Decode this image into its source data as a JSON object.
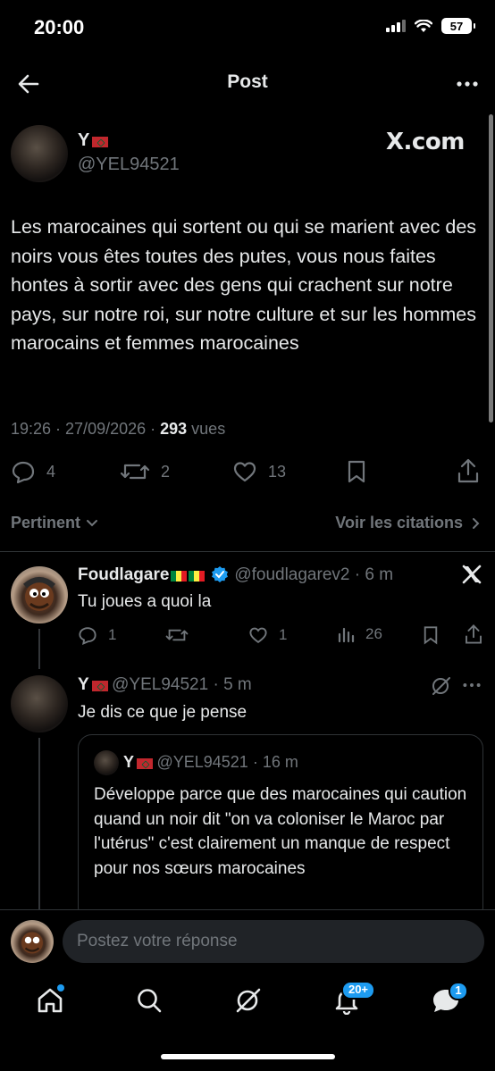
{
  "status_bar": {
    "time": "20:00",
    "battery": "57"
  },
  "header": {
    "title": "Post"
  },
  "post": {
    "display_name": "Y",
    "handle": "@YEL94521",
    "source_label": "X.com",
    "text": "Les marocaines qui sortent ou qui se marient avec des noirs vous êtes toutes des putes, vous nous faites hontes à sortir avec des gens qui crachent sur notre pays, sur notre roi, sur notre culture et sur les hommes marocains et femmes marocaines",
    "time": "19:26 · 27/09/2026 · ",
    "views_count": "293",
    "views_label": " vues",
    "replies": "4",
    "reposts": "2",
    "likes": "13"
  },
  "sort": {
    "label": "Pertinent",
    "quotes_label": "Voir les citations"
  },
  "replies": [
    {
      "display_name": "Foudlagare",
      "handle": "@foudlagarev2",
      "time": " · 6 m",
      "text": "Tu joues a quoi la",
      "replies": "1",
      "likes": "1",
      "views": "26"
    },
    {
      "display_name": "Y",
      "handle": "@YEL94521",
      "time": " · 5 m",
      "text": "Je dis ce que je pense",
      "quote": {
        "display_name": "Y",
        "handle": "@YEL94521",
        "time": " · 16 m",
        "text": "Développe parce que des marocaines qui caution quand un noir dit \"on va coloniser le Maroc par l'utérus\" c'est clairement un manque de respect pour nos sœurs marocaines"
      }
    }
  ],
  "composer": {
    "placeholder": "Postez votre réponse"
  },
  "tab_bar": {
    "notifications_badge": "20+",
    "messages_badge": "1"
  }
}
